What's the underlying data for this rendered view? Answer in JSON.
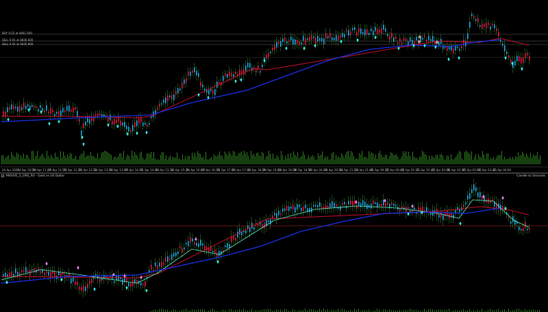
{
  "top_pane": {
    "order_lines": [
      {
        "label": "BUY 0.03 at 4841.000",
        "color": "#606060"
      },
      {
        "label": "SELL 0.01 at 4836.000",
        "color": "#606060"
      },
      {
        "label": "SELL 0.05 at 4835.960",
        "color": "#606060"
      }
    ],
    "time_labels": [
      "24 Apr 2026",
      "24 Apr 10:59",
      "24 Apr 11:27",
      "24 Apr 11:55",
      "24 Apr 12:23",
      "24 Apr 12:51",
      "24 Apr 13:19",
      "24 Apr 13:47",
      "24 Apr 14:15",
      "24 Apr 14:43",
      "24 Apr 15:11",
      "24 Apr 15:39",
      "24 Apr 16:07",
      "24 Apr 16:35",
      "24 Apr 17:03",
      "24 Apr 17:31",
      "24 Apr 18:29",
      "24 Apr 19:00",
      "24 Apr 19:28",
      "24 Apr 19:56",
      "24 Apr 20:24",
      "24 Apr 20:52",
      "24 Apr 21:20",
      "24 Apr 21:48",
      "25 Apr 00:16",
      "25 Apr 00:44",
      "25 Apr 01:12",
      "25 Apr 01:40",
      "25 Apr 02:08",
      "25 Apr 02:36",
      "25 Apr 03:04",
      "25 Apr 03:32",
      "25 Apr 04:00"
    ]
  },
  "bottom_pane": {
    "title": "MOUVE_5_ORE_R0 · Gold vs US Dollar",
    "right_label": "Candle to Seconds",
    "level_color": "#8b1a1a"
  },
  "colors": {
    "background": "#000000",
    "candle_up": "#1fa9e6",
    "candle_down": "#e01840",
    "ma_slow": "#1a2fe6",
    "ma_red": "#c8102e",
    "buy_arrow": "#36f0e6",
    "sell_arrow": "#e98af0",
    "volume": "#2e7d1f",
    "ma_fast_bottom": "#5ff0c0"
  },
  "icons": {
    "pane_marker": "square-icon",
    "buy_signal": "up-arrow-icon",
    "sell_signal": "down-arrow-icon"
  }
}
